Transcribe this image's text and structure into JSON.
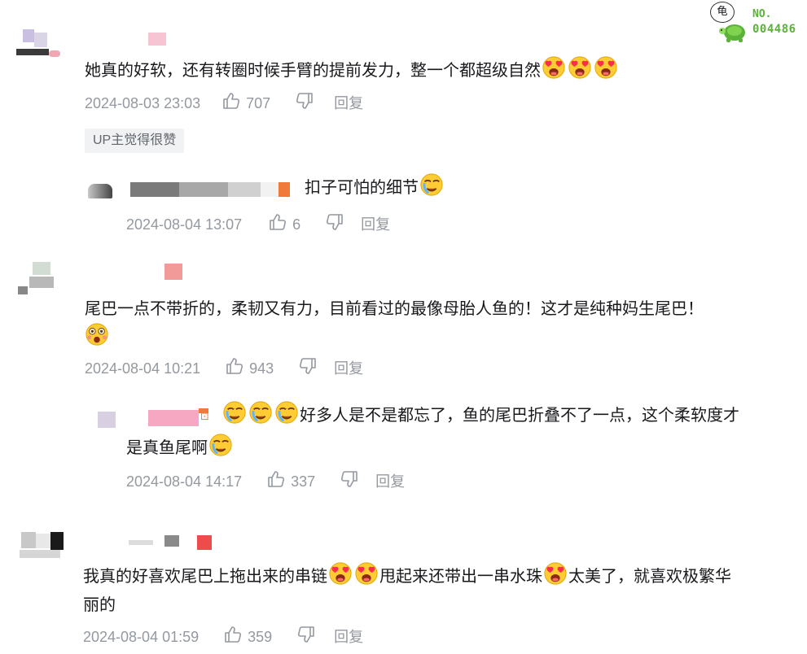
{
  "watermark": {
    "bubble_char": "龟",
    "label": "NO.",
    "number": "004486"
  },
  "comments": [
    {
      "text": "她真的好软，还有转圈时候手臂的提前发力，整一个都超级自然",
      "time": "2024-08-03 23:03",
      "likes": "707",
      "reply": "回复",
      "tag": "UP主觉得很赞"
    },
    {
      "text": "扣子可怕的细节",
      "time": "2024-08-04 13:07",
      "likes": "6",
      "reply": "回复"
    },
    {
      "text": "尾巴一点不带折的，柔韧又有力，目前看过的最像母胎人鱼的！这才是纯种妈生尾巴！",
      "time": "2024-08-04 10:21",
      "likes": "943",
      "reply": "回复"
    },
    {
      "text_line1": "好多人是不是都忘了，鱼的尾巴折叠不了一点，这个柔软度才",
      "text_line2": "是真鱼尾啊",
      "time": "2024-08-04 14:17",
      "likes": "337",
      "reply": "回复"
    },
    {
      "text_a": "我真的好喜欢尾巴上拖出来的串链",
      "text_b": "甩起来还带出一串水珠",
      "text_c": "太美了，就喜欢极繁华",
      "text_line2": "丽的",
      "time": "2024-08-04 01:59",
      "likes": "359",
      "reply": "回复"
    }
  ],
  "colors": {
    "text": "#18191c",
    "meta": "#9499a0",
    "tag_bg": "#f1f2f3",
    "watermark_green": "#5bb239"
  },
  "icons": [
    "like-icon",
    "dislike-icon",
    "heart-eyes-emoji",
    "tear-emoji",
    "astonished-emoji",
    "turtle-icon"
  ]
}
